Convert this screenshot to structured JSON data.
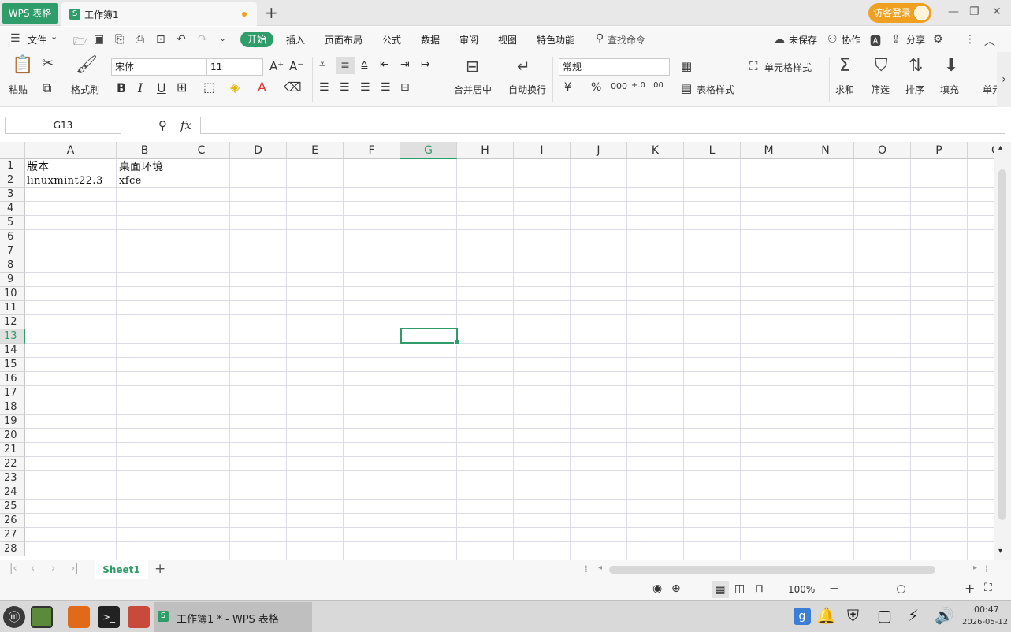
{
  "titlebar": {
    "app_badge": "WPS 表格",
    "doc_tab_label": "工作簿1",
    "login_label": "访客登录",
    "new_tab": "+"
  },
  "menu": {
    "file": "文件",
    "tabs": [
      "开始",
      "插入",
      "页面布局",
      "公式",
      "数据",
      "审阅",
      "视图",
      "特色功能"
    ],
    "search": "查找命令",
    "unsaved": "未保存",
    "collab": "协作",
    "share": "分享"
  },
  "ribbon": {
    "paste": "粘贴",
    "format_painter": "格式刷",
    "font_name": "宋体",
    "font_size": "11",
    "merge_center": "合并居中",
    "wrap_text": "自动换行",
    "number_format": "常规",
    "cell_style": "单元格样式",
    "table_style": "表格样式",
    "sum": "求和",
    "filter": "筛选",
    "sort": "排序",
    "fill": "填充",
    "cell": "单元"
  },
  "formula_bar": {
    "name_box": "G13",
    "fx": "fx",
    "value": ""
  },
  "grid": {
    "columns": [
      "A",
      "B",
      "C",
      "D",
      "E",
      "F",
      "G",
      "H",
      "I",
      "J",
      "K",
      "L",
      "M",
      "N",
      "O",
      "P",
      "Q"
    ],
    "rows": [
      "1",
      "2",
      "3",
      "4",
      "5",
      "6",
      "7",
      "8",
      "9",
      "10",
      "11",
      "12",
      "13",
      "14",
      "15",
      "16",
      "17",
      "18",
      "19",
      "20",
      "21",
      "22",
      "23",
      "24",
      "25",
      "26",
      "27",
      "28"
    ],
    "cells": {
      "A1": "版本",
      "B1": "桌面环境",
      "A2": "linuxmint22.3",
      "B2": "xfce"
    },
    "selected_cell": "G13",
    "accent": "#2f9d6a"
  },
  "sheets": {
    "active": "Sheet1",
    "add": "+"
  },
  "status": {
    "zoom": "100%"
  },
  "taskbar": {
    "window_title": "工作簿1 * - WPS 表格",
    "time": "00:47",
    "date": "2026-05-12"
  }
}
